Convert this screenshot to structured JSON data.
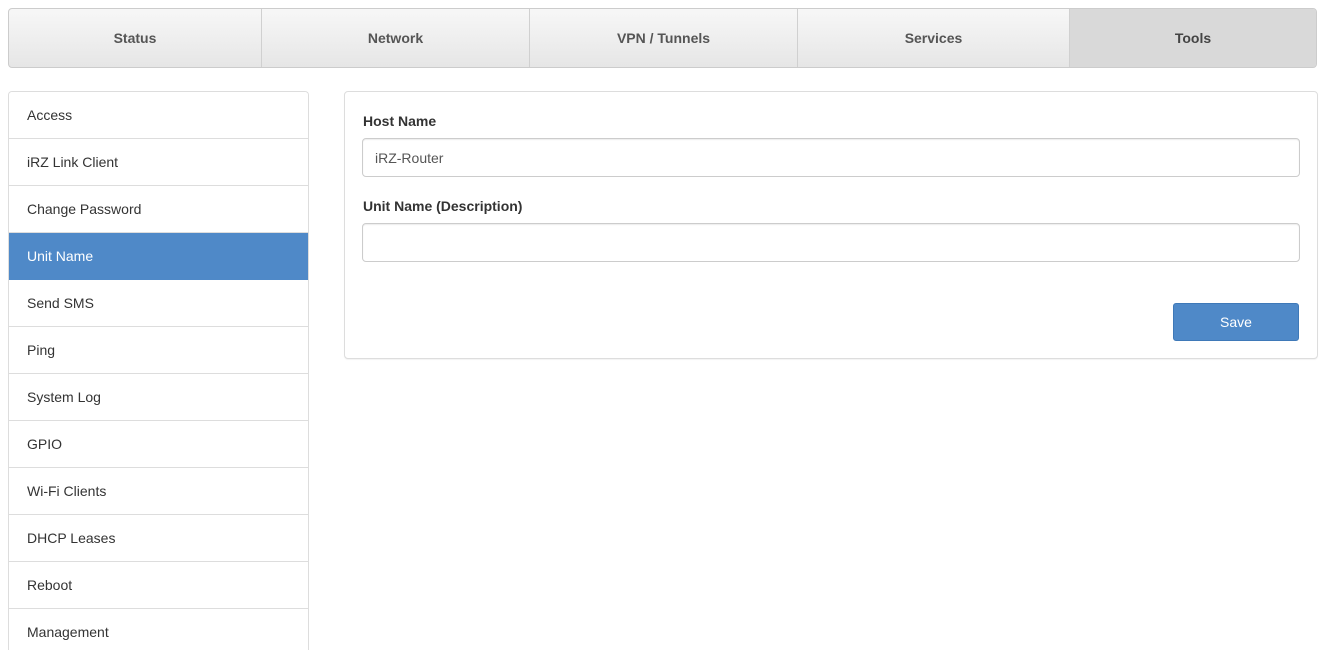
{
  "topnav": {
    "tabs": [
      {
        "label": "Status"
      },
      {
        "label": "Network"
      },
      {
        "label": "VPN / Tunnels"
      },
      {
        "label": "Services"
      },
      {
        "label": "Tools"
      }
    ],
    "active_tab": "Tools"
  },
  "sidebar": {
    "items": [
      {
        "label": "Access"
      },
      {
        "label": "iRZ Link Client"
      },
      {
        "label": "Change Password"
      },
      {
        "label": "Unit Name"
      },
      {
        "label": "Send SMS"
      },
      {
        "label": "Ping"
      },
      {
        "label": "System Log"
      },
      {
        "label": "GPIO"
      },
      {
        "label": "Wi-Fi Clients"
      },
      {
        "label": "DHCP Leases"
      },
      {
        "label": "Reboot"
      },
      {
        "label": "Management"
      }
    ],
    "active_item": "Unit Name"
  },
  "form": {
    "host_name_label": "Host Name",
    "host_name_value": "iRZ-Router",
    "unit_name_label": "Unit Name (Description)",
    "unit_name_value": "",
    "save_label": "Save"
  },
  "colors": {
    "accent": "#4f89c8",
    "active_tab_bg": "#d9d9d9"
  }
}
